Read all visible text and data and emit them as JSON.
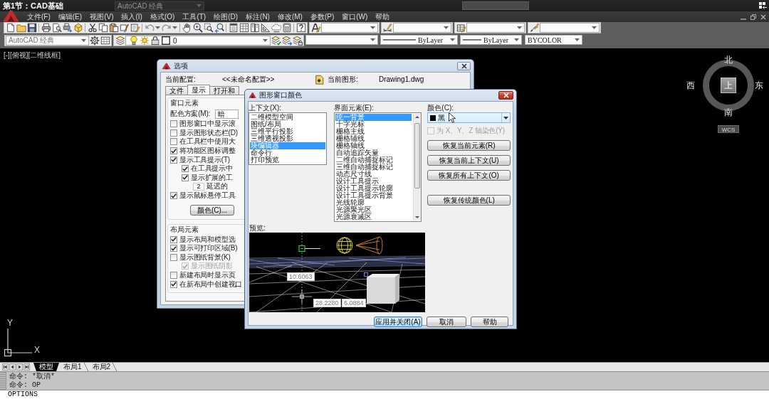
{
  "video_title": "第1节：CAD基础",
  "quick_access": {
    "workspace": "AutoCAD 经典"
  },
  "menu_bar": [
    "文件(F)",
    "编辑(E)",
    "视图(V)",
    "插入(I)",
    "格式(O)",
    "工具(T)",
    "绘图(D)",
    "标注(N)",
    "修改(M)",
    "参数(P)",
    "窗口(W)",
    "帮助"
  ],
  "toolbar": {
    "workspace": "AutoCAD 经典",
    "layer": "0",
    "linetype": "ByLayer",
    "lineweight": "ByLayer",
    "plot_style": "BYCOLOR"
  },
  "viewport": {
    "label": "[-][俯视][二维线框]",
    "viewcube": {
      "north": "北",
      "west": "西",
      "face": "上",
      "east": "东",
      "south": "南",
      "coordinate_system": "WCS"
    },
    "ucs_icon": {
      "y": "Y",
      "x": "X"
    }
  },
  "options_dialog": {
    "title": "选项",
    "profile_label": "当前配置:",
    "profile": "<<未命名配置>>",
    "drawing_label": "当前图形:",
    "drawing": "Drawing1.dwg",
    "tabs": [
      {
        "label": "文件",
        "selected": false
      },
      {
        "label": "显示",
        "selected": true
      },
      {
        "label": "打开和",
        "selected": false
      }
    ],
    "window_elements": {
      "title": "窗口元素",
      "color_scheme_label": "配色方案(M):",
      "color_scheme": "暗",
      "items": [
        {
          "kind": "checkbox",
          "label": "图形窗口中显示滚",
          "checked": false
        },
        {
          "kind": "checkbox",
          "label": "显示图形状态栏(D)",
          "checked": false
        },
        {
          "kind": "checkbox",
          "label": "在工具栏中使用大",
          "checked": false
        },
        {
          "kind": "checkbox",
          "label": "将功能区图标调整",
          "checked": true
        },
        {
          "kind": "checkbox",
          "label": "显示工具提示(T)",
          "checked": true,
          "children": [
            {
              "kind": "checkbox",
              "label": "在工具提示中",
              "checked": true
            },
            {
              "kind": "checkbox",
              "label": "显示扩展的工",
              "checked": true,
              "children": [
                {
                  "kind": "spinner",
                  "value": "2",
                  "label": "延迟的"
                }
              ]
            }
          ]
        },
        {
          "kind": "checkbox",
          "label": "显示鼠标悬停工具",
          "checked": true
        },
        {
          "kind": "button",
          "label": "颜色(C)..."
        }
      ]
    },
    "layout_elements": {
      "title": "布局元素",
      "items": [
        {
          "kind": "checkbox",
          "label": "显示布局和模型选",
          "checked": true
        },
        {
          "kind": "checkbox",
          "label": "显示可打印区域(B)",
          "checked": true
        },
        {
          "kind": "checkbox",
          "label": "显示图纸背景(K)",
          "checked": false,
          "children": [
            {
              "kind": "checkbox",
              "label": "显示图纸阴影",
              "checked": true,
              "disabled": true
            }
          ]
        },
        {
          "kind": "checkbox",
          "label": "新建布局时显示页",
          "checked": false
        },
        {
          "kind": "checkbox",
          "label": "在新布局中创建视口",
          "checked": true
        }
      ]
    }
  },
  "color_dialog": {
    "title": "图形窗口颜色",
    "context_label": "上下文(X):",
    "contexts": [
      {
        "label": "二维模型空间",
        "selected": false
      },
      {
        "label": "图纸/布局",
        "selected": false
      },
      {
        "label": "三维平行投影",
        "selected": false
      },
      {
        "label": "三维透视投影",
        "selected": false
      },
      {
        "label": "块编辑器",
        "selected": true
      },
      {
        "label": "命令行",
        "selected": false
      },
      {
        "label": "打印预览",
        "selected": false
      }
    ],
    "element_label": "界面元素(E):",
    "elements": [
      {
        "label": "统一背景",
        "selected": true
      },
      {
        "label": "十字光标",
        "selected": false
      },
      {
        "label": "栅格主线",
        "selected": false
      },
      {
        "label": "栅格辅线",
        "selected": false
      },
      {
        "label": "栅格轴线",
        "selected": false
      },
      {
        "label": "自动追踪矢量",
        "selected": false
      },
      {
        "label": "二维自动捕捉标记",
        "selected": false
      },
      {
        "label": "三维自动捕捉标记",
        "selected": false
      },
      {
        "label": "动态尺寸线",
        "selected": false
      },
      {
        "label": "设计工具提示",
        "selected": false
      },
      {
        "label": "设计工具提示轮廓",
        "selected": false
      },
      {
        "label": "设计工具提示背景",
        "selected": false
      },
      {
        "label": "光线轮廓",
        "selected": false
      },
      {
        "label": "光源聚光区",
        "selected": false
      },
      {
        "label": "光源衰减区",
        "selected": false
      }
    ],
    "color_label": "颜色(C):",
    "dropdown_value": "黑",
    "axis_tint": {
      "label": "为 X、Y、Z 轴染色(Y)",
      "checked": false,
      "disabled": true
    },
    "reset_buttons": [
      "恢复当前元素(R)",
      "恢复当前上下文(U)",
      "恢复所有上下文(O)",
      "恢复传统颜色(L)"
    ],
    "preview_label": "预览:",
    "preview_dimensions": [
      "10.6063",
      "28.2280",
      "6.0884"
    ],
    "buttons": [
      {
        "label": "应用并关闭(A)",
        "default": true
      },
      {
        "label": "取消",
        "default": false
      },
      {
        "label": "帮助",
        "default": false
      }
    ]
  },
  "layout_tabs": [
    {
      "label": "模型",
      "selected": true
    },
    {
      "label": "布局1",
      "selected": false
    },
    {
      "label": "布局2",
      "selected": false
    }
  ],
  "command_line": {
    "history": [
      "命令: *取消*",
      "命令: OP"
    ],
    "input": "OPTIONS"
  }
}
